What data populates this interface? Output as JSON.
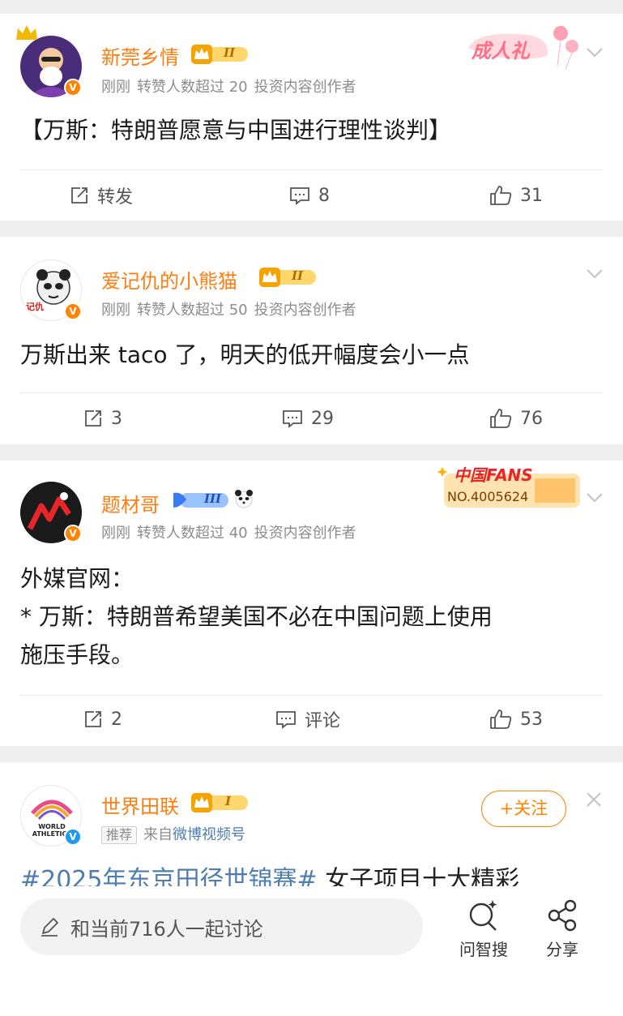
{
  "posts": [
    {
      "username": "新莞乡情",
      "crown_level": "II",
      "time": "刚刚",
      "repost_info": "转赞人数超过 20",
      "creator_tag": "投资内容创作者",
      "medal_text": "成人礼",
      "content": "【万斯：特朗普愿意与中国进行理性谈判】",
      "actions": {
        "repost": "转发",
        "comments": "8",
        "likes": "31"
      }
    },
    {
      "username": "爱记仇的小熊猫",
      "crown_level": "II",
      "time": "刚刚",
      "repost_info": "转赞人数超过 50",
      "creator_tag": "投资内容创作者",
      "avatar_text": "记仇",
      "content": "万斯出来 taco 了，明天的低开幅度会小一点",
      "actions": {
        "repost": "3",
        "comments": "29",
        "likes": "76"
      }
    },
    {
      "username": "题材哥",
      "crown_level": "III",
      "time": "刚刚",
      "repost_info": "转赞人数超过 40",
      "creator_tag": "投资内容创作者",
      "medal_title": "中国FANS",
      "medal_number": "NO.4005624",
      "content_lines": [
        "外媒官网：",
        "* 万斯：特朗普希望美国不必在中国问题上使用",
        "施压手段。"
      ],
      "actions": {
        "repost": "2",
        "comments": "评论",
        "likes": "53"
      }
    },
    {
      "username": "世界田联",
      "crown_level": "I",
      "recommend_tag": "推荐",
      "source_prefix": "来自",
      "source_link": "微博视频号",
      "follow_label": "+关注",
      "avatar_text": "WORLD ATHLETICS",
      "topic": "#2025年东京田径世锦赛#",
      "topic_rest": " 女子项目十大精彩"
    }
  ],
  "bottom_bar": {
    "comment_placeholder": "和当前716人一起讨论",
    "search_label": "问智搜",
    "share_label": "分享"
  },
  "colors": {
    "username": "#ff7d11",
    "verify_badge": "#ff8200",
    "link": "#507daf",
    "background": "#efefef"
  }
}
